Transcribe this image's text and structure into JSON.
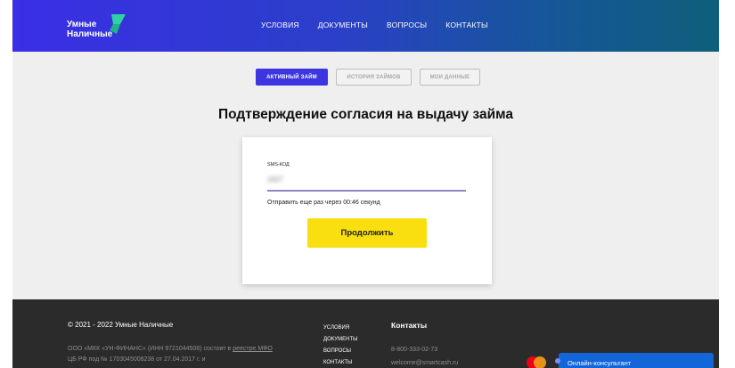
{
  "header": {
    "logo_line1": "Умные",
    "logo_line2": "Наличные",
    "nav": [
      "УСЛОВИЯ",
      "ДОКУМЕНТЫ",
      "ВОПРОСЫ",
      "КОНТАКТЫ"
    ]
  },
  "tabs": [
    "АКТИВНЫЙ ЗАЙМ",
    "ИСТОРИЯ ЗАЙМОВ",
    "МОИ ДАННЫЕ"
  ],
  "page_title": "Подтверждение согласия на выдачу займа",
  "form": {
    "field_label": "SMS-КОД",
    "field_value": "1627",
    "resend_text": "Отправить еще раз через 00:46 секунд",
    "submit_label": "Продолжить"
  },
  "footer": {
    "copyright": "© 2021 - 2022 Умные Наличные",
    "legal_line1_prefix": "ООО «МКК «УН-ФИНАНС» (ИНН 9721044508) состоит в ",
    "legal_link": "реестре МФО",
    "legal_line2": "ЦБ РФ под № 1703045008238 от 27.04.2017 г. и",
    "links": [
      "УСЛОВИЯ",
      "ДОКУМЕНТЫ",
      "ВОПРОСЫ",
      "КОНТАКТЫ"
    ],
    "contacts_title": "Контакты",
    "phone": "8-800-333-02-73",
    "email": "welcome@smartcash.ru",
    "chat_label": "Онлайн-консультант"
  },
  "colors": {
    "accent": "#3d35e0",
    "button": "#f9df0f",
    "chat": "#1266d8",
    "footer": "#2b2b2b"
  }
}
